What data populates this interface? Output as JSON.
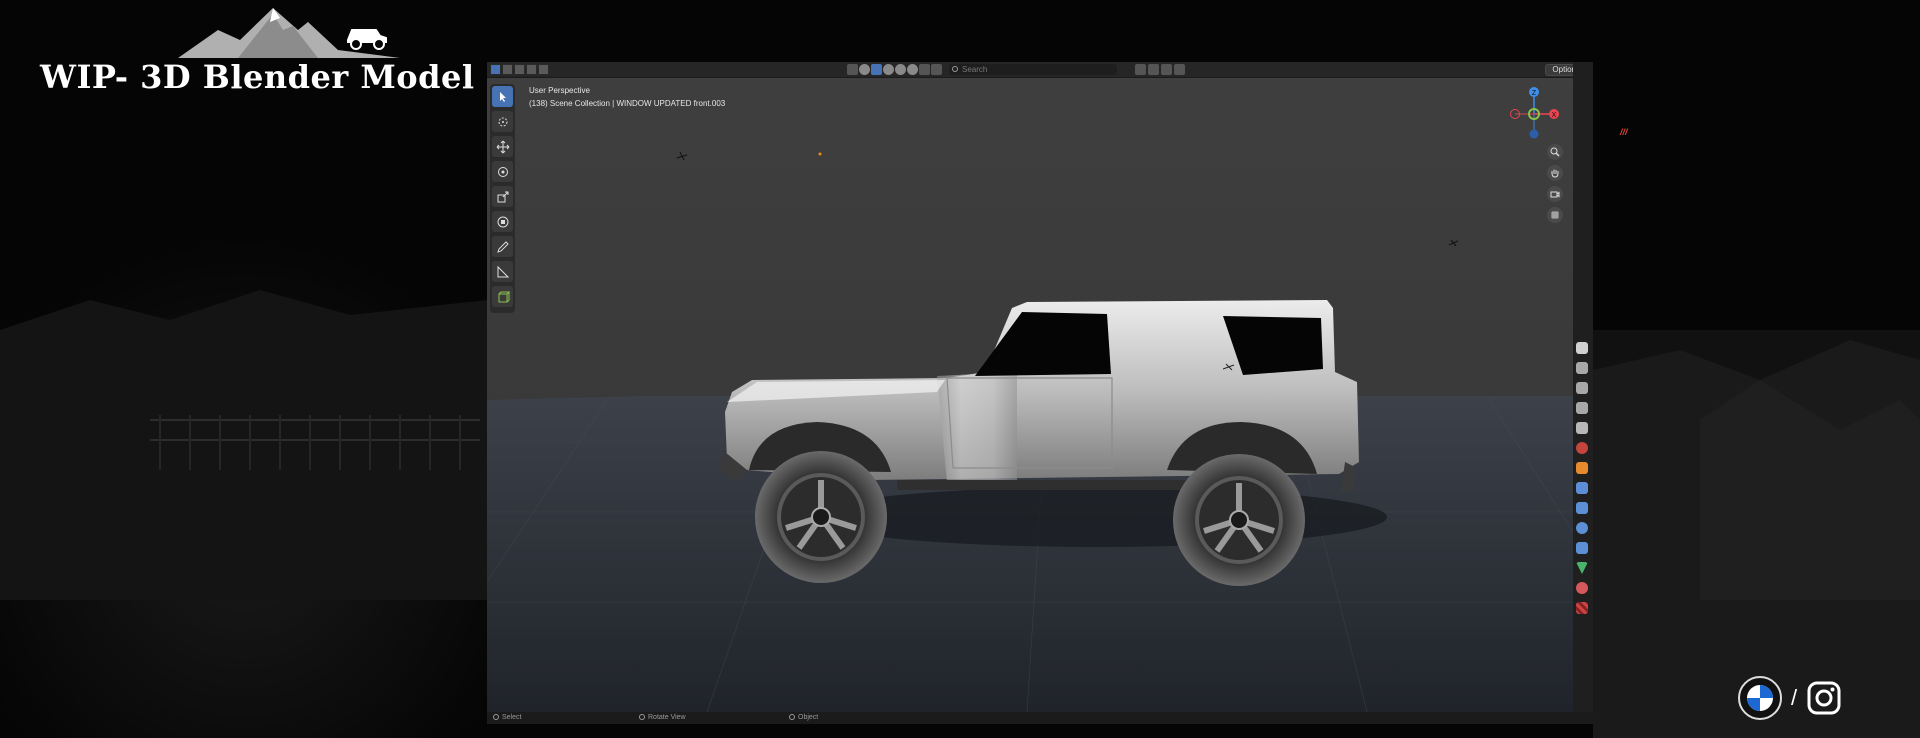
{
  "page": {
    "title": "WIP- 3D Blender Model"
  },
  "header": {
    "search_placeholder": "Search",
    "options_label": "Options",
    "mode_buttons": 5
  },
  "viewport": {
    "view_name": "User Perspective",
    "collection_info": "(138) Scene Collection | WINDOW UPDATED front.003"
  },
  "toolbar": {
    "tools": [
      "select-box",
      "cursor",
      "move",
      "rotate",
      "scale",
      "transform",
      "annotate",
      "measure",
      "add-cube"
    ],
    "active_tool": "select-box"
  },
  "gizmo": {
    "axes": [
      "Z",
      "X"
    ],
    "colors": {
      "x": "#e8454f",
      "y": "#8bc34a",
      "z": "#3f8ee8"
    }
  },
  "nav_buttons": [
    "zoom-icon",
    "hand-pan-icon",
    "camera-icon",
    "grid-icon"
  ],
  "status_bar": {
    "items": [
      "Select",
      "Rotate View",
      "Object"
    ]
  },
  "properties_icons": [
    "tool-icon",
    "render-icon",
    "output-icon",
    "view-layer-icon",
    "scene-icon",
    "world-icon",
    "object-icon",
    "modifier-icon",
    "particles-icon",
    "physics-icon",
    "constraints-icon",
    "data-icon",
    "material-icon",
    "texture-icon"
  ],
  "decor": {
    "slash_marks": "///",
    "separator": "/"
  },
  "colors": {
    "accent": "#4772b3",
    "viewport_bg": "#3d3d3d",
    "header_bg": "#262626"
  }
}
